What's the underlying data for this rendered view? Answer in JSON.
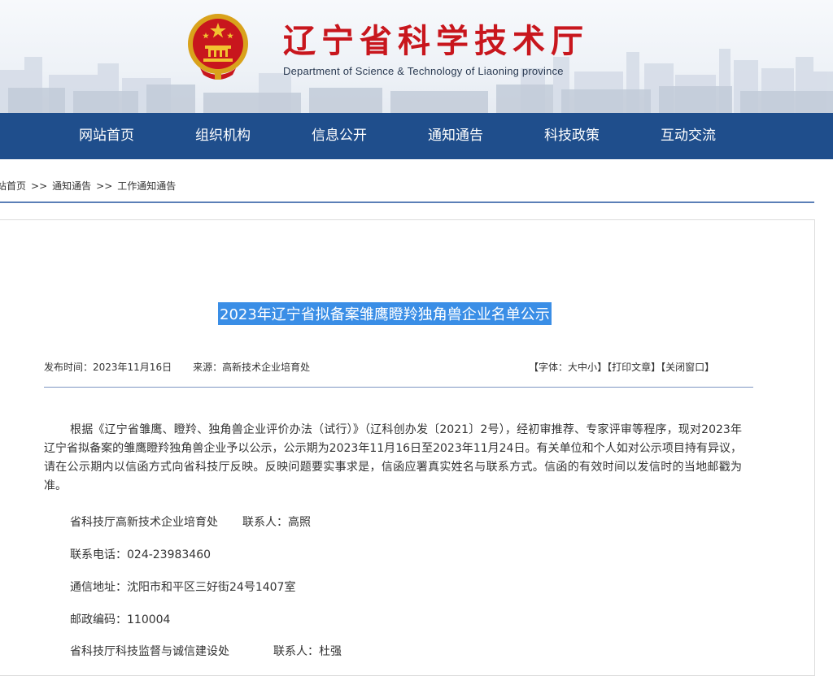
{
  "header": {
    "title": "辽宁省科学技术厅",
    "subtitle": "Department of Science & Technology of Liaoning province"
  },
  "nav": {
    "items": [
      "网站首页",
      "组织机构",
      "信息公开",
      "通知通告",
      "科技政策",
      "互动交流"
    ]
  },
  "breadcrumb": {
    "home": "站首页",
    "sep": ">>",
    "level1": "通知通告",
    "level2": "工作通知通告"
  },
  "article": {
    "title": "2023年辽宁省拟备案雏鹰瞪羚独角兽企业名单公示",
    "publish_time": "发布时间：2023年11月16日",
    "source": "来源：高新技术企业培育处",
    "tools": {
      "font_prefix": "【字体：",
      "font_large": "大",
      "font_medium": "中",
      "font_small": "小",
      "font_suffix": "】",
      "print": "【打印文章】",
      "close": "【关闭窗口】"
    },
    "body": "根据《辽宁省雏鹰、瞪羚、独角兽企业评价办法（试行）》（辽科创办发〔2021〕2号），经初审推荐、专家评审等程序，现对2023年辽宁省拟备案的雏鹰瞪羚独角兽企业予以公示，公示期为2023年11月16日至2023年11月24日。有关单位和个人如对公示项目持有异议，请在公示期内以信函方式向省科技厅反映。反映问题要实事求是，信函应署真实姓名与联系方式。信函的有效时间以发信时的当地邮戳为准。",
    "contact1_dept": "省科技厅高新技术企业培育处",
    "contact1_person": "联系人：高照",
    "phone": "联系电话：024-23983460",
    "address": "通信地址：沈阳市和平区三好街24号1407室",
    "postcode": "邮政编码：110004",
    "contact2_dept": "省科技厅科技监督与诚信建设处",
    "contact2_person": "联系人：杜强"
  },
  "colors": {
    "nav_bg": "#1f4e8c",
    "title_red": "#c8161d",
    "selection": "#3a8ee6"
  }
}
